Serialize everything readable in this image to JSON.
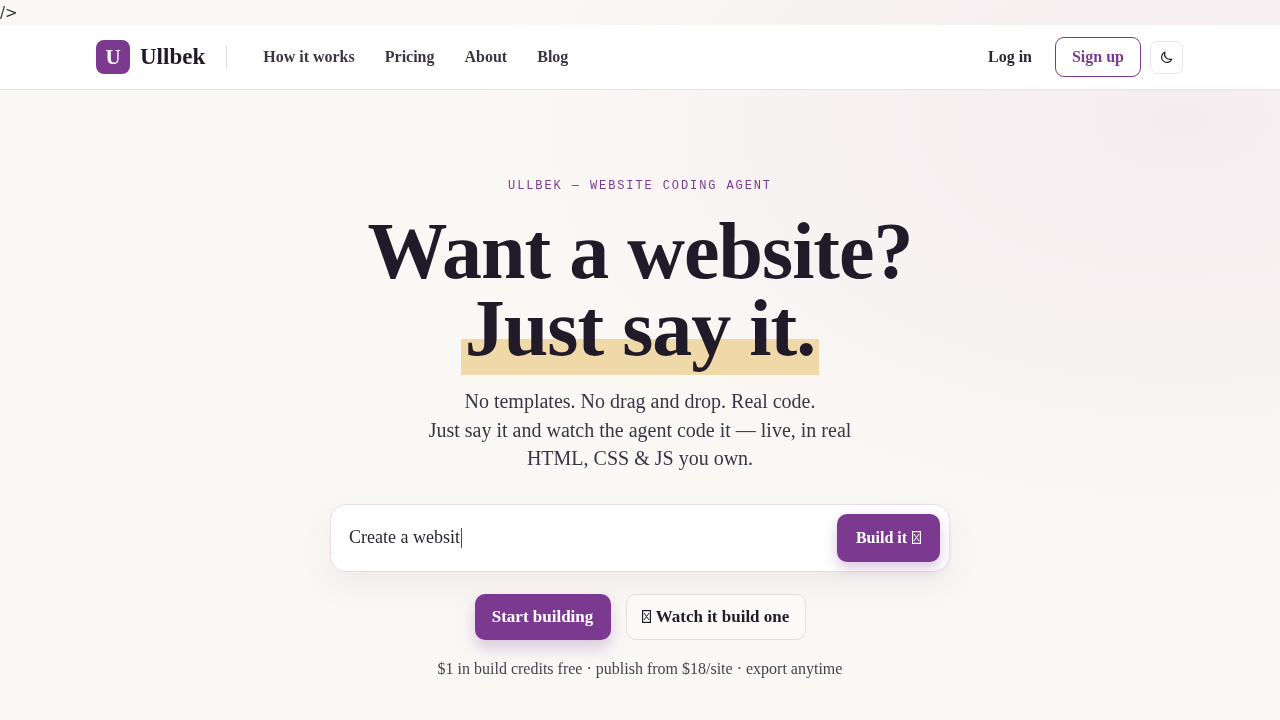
{
  "stray_text": "/>",
  "nav": {
    "logo": {
      "letter": "U",
      "name": "Ullbek"
    },
    "links": [
      {
        "label": "How it works"
      },
      {
        "label": "Pricing"
      },
      {
        "label": "About"
      },
      {
        "label": "Blog"
      }
    ],
    "login": "Log in",
    "signup": "Sign up"
  },
  "hero": {
    "eyebrow": "ULLBEK — WEBSITE CODING AGENT",
    "headline": [
      {
        "text": "Want a website?",
        "highlighted": false
      },
      {
        "text": "Just say it.",
        "highlighted": true
      }
    ],
    "description": [
      "No templates. No drag and drop. Real code.",
      "Just say it and watch the agent code it — live, in real",
      "HTML, CSS & JS you own."
    ],
    "prompt": {
      "value": "Create a websit",
      "button": "Build it"
    },
    "actions": [
      {
        "label": "Start building",
        "kind": "primary"
      },
      {
        "label": "Watch it build one",
        "kind": "secondary"
      }
    ],
    "note": "$1 in build credits free · publish from $18/site · export anytime"
  }
}
